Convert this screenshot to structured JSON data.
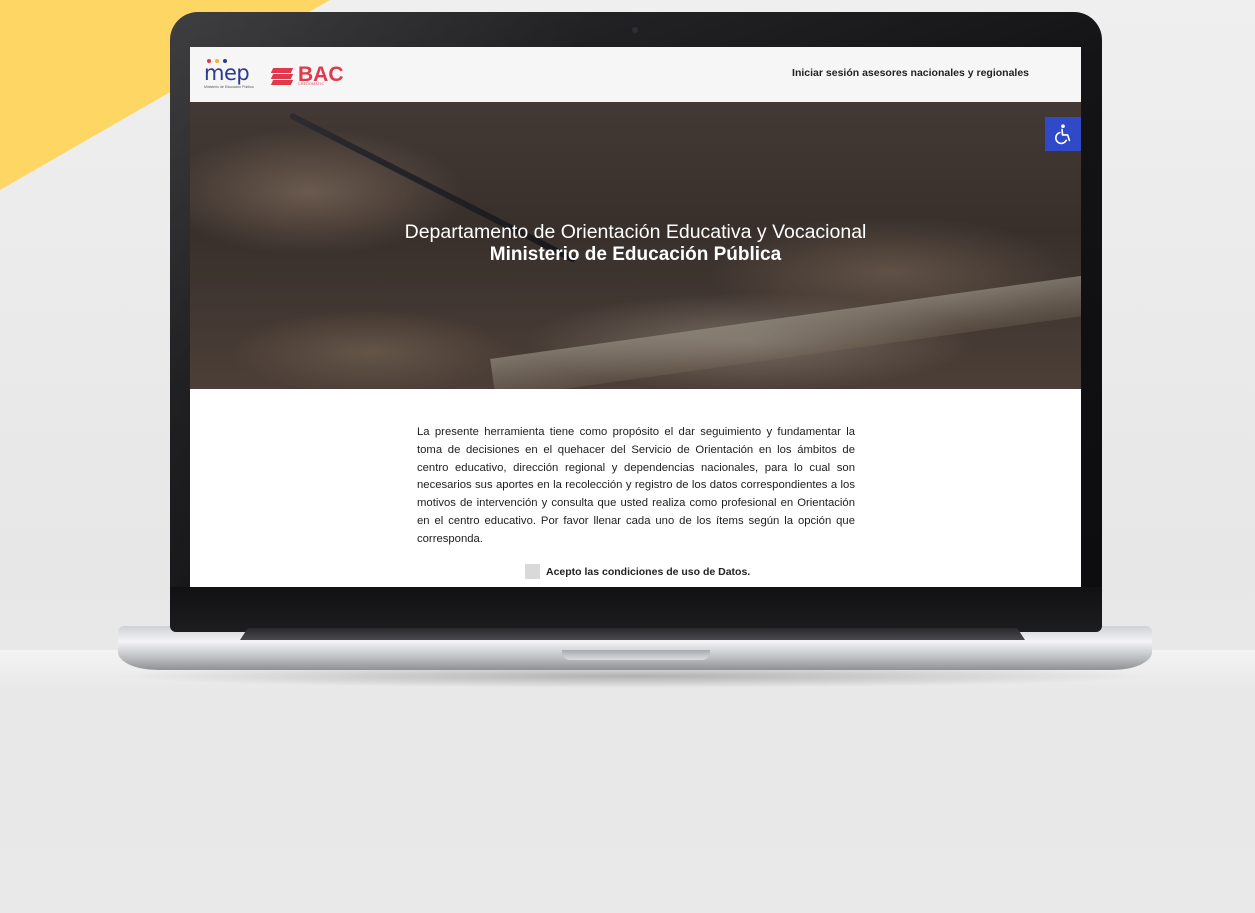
{
  "header": {
    "mep_logo": "mep",
    "mep_logo_subtitle": "Ministerio de Educación Pública",
    "bac_logo": "BAC",
    "bac_logo_subtitle": "CREDOMATIC",
    "login_link": "Iniciar sesión asesores nacionales y regionales"
  },
  "hero": {
    "title": "Departamento de Orientación Educativa y Vocacional",
    "subtitle": "Ministerio de Educación Pública",
    "accessibility_icon": "wheelchair-icon"
  },
  "main": {
    "intro_text": "La presente herramienta tiene como propósito el dar seguimiento y fundamentar la toma de decisiones en el quehacer del Servicio de Orientación en los ámbitos de centro educativo, dirección regional y dependencias nacionales, para lo cual son necesarios sus aportes en la recolección y registro de los datos correspondientes a los motivos de intervención y consulta que usted realiza como profesional en Orientación en el centro educativo. Por favor llenar cada uno de los ítems según la opción que corresponda.",
    "accept_label": "Acepto las condiciones de uso de Datos.",
    "accept_checked": false
  },
  "colors": {
    "accent_yellow": "#fdd663",
    "mep_blue": "#2b3a8f",
    "bac_red": "#e0384d",
    "accessibility_blue": "#2f49c9"
  }
}
